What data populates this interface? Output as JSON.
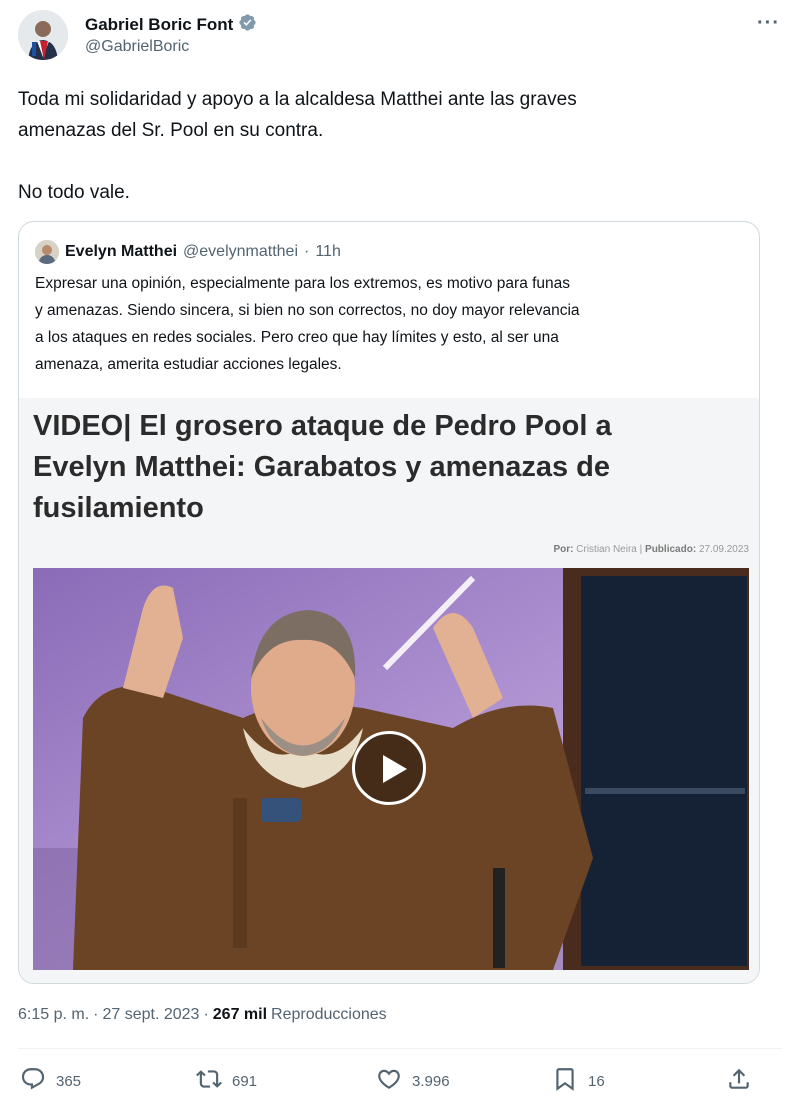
{
  "author": {
    "display_name": "Gabriel Boric Font",
    "handle": "@GabrielBoric",
    "verified_icon": "verified-badge-icon"
  },
  "tweet": {
    "line1": "Toda mi solidaridad y apoyo a la alcaldesa Matthei ante las graves",
    "line2": "amenazas del Sr. Pool en su contra.",
    "line3": "No todo vale."
  },
  "quoted": {
    "name": "Evelyn Matthei",
    "handle": "@evelynmatthei",
    "separator": "·",
    "time": "11h",
    "lines": [
      "Expresar una opinión, especialmente para los extremos, es motivo para funas",
      "y amenazas. Siendo sincera, si bien no son correctos, no doy mayor relevancia",
      "a los ataques en redes sociales. Pero creo que hay límites y esto, al ser una",
      "amenaza, amerita estudiar acciones legales."
    ],
    "article": {
      "title_lines": [
        "VIDEO| El grosero ataque de Pedro Pool a",
        "Evelyn Matthei: Garabatos y amenazas de",
        "fusilamiento"
      ],
      "by_label": "Por:",
      "by_name": "Cristian Neira",
      "pub_sep": "|",
      "pub_label": "Publicado:",
      "pub_date": "27.09.2023"
    }
  },
  "meta": {
    "time": "6:15 p. m.",
    "sep1": "·",
    "date": "27 sept. 2023",
    "sep2": "·",
    "views_count": "267 mil",
    "views_label": "Reproducciones"
  },
  "actions": {
    "replies": "365",
    "retweets": "691",
    "likes": "3.996",
    "bookmarks": "16"
  },
  "colors": {
    "text": "#0f1419",
    "secondary": "#536471",
    "verified": "#829aab",
    "border": "#cfd9de"
  }
}
